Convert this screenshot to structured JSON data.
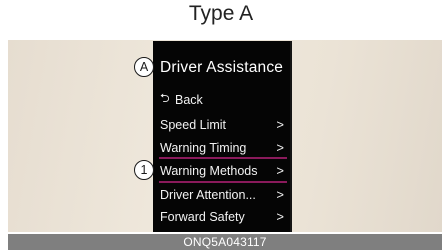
{
  "variant_title": "Type A",
  "callouts": {
    "a": "A",
    "one": "1"
  },
  "menu": {
    "title": "Driver Assistance",
    "back_icon": "back-arrow-icon",
    "back_label": "Back",
    "items": [
      {
        "label": "Speed Limit",
        "chevron": ">"
      },
      {
        "label": "Warning Timing",
        "chevron": ">"
      },
      {
        "label": "Warning Methods",
        "chevron": ">",
        "selected": true
      },
      {
        "label": "Driver Attention...",
        "chevron": ">"
      },
      {
        "label": "Forward Safety",
        "chevron": ">"
      }
    ]
  },
  "caption": "ONQ5A043117",
  "colors": {
    "screen_bg": "#050505",
    "selection_underline": "#8a1a5b",
    "caption_bar": "#7f7f7f"
  }
}
